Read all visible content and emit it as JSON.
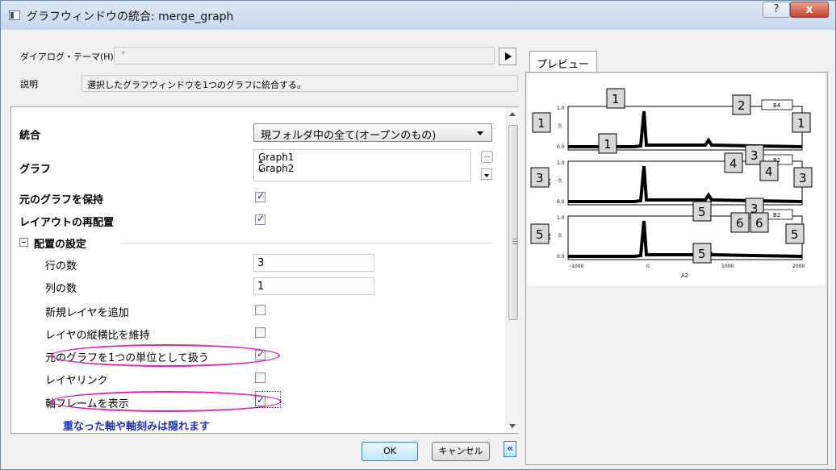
{
  "window": {
    "title": "グラフウィンドウの統合: merge_graph",
    "help_label": "?",
    "close_label": "x"
  },
  "header": {
    "theme_label": "ダイアログ・テーマ(H)",
    "theme_value": "*",
    "description_label": "説明",
    "description_value": "選択したグラフウィンドウを1つのグラフに統合する。"
  },
  "settings": {
    "merge_label": "統合",
    "merge_value": "現フォルダ中の全て(オープンのもの)",
    "graphs_label": "グラフ",
    "graphs": [
      "Graph1",
      "Graph2"
    ],
    "ellipsis_label": "...",
    "keep_source_label": "元のグラフを保持",
    "keep_source_checked": true,
    "rearrange_label": "レイアウトの再配置",
    "rearrange_checked": true,
    "arrangement_group_label": "配置の設定",
    "rows_label": "行の数",
    "rows_value": "3",
    "cols_label": "列の数",
    "cols_value": "1",
    "add_layer_label": "新規レイヤを追加",
    "add_layer_checked": false,
    "keep_ratio_label": "レイヤの縦横比を維持",
    "keep_ratio_checked": false,
    "treat_unit_label": "元のグラフを1つの単位として扱う",
    "treat_unit_checked": true,
    "layer_link_label": "レイヤリンク",
    "layer_link_checked": false,
    "show_frame_label": "軸フレームを表示",
    "show_frame_checked": true,
    "note": "重なった軸や軸刻みは隠れます"
  },
  "buttons": {
    "ok": "OK",
    "cancel": "キャンセル",
    "collapse": "«"
  },
  "preview": {
    "tab_label": "プレビュー",
    "panels": [
      {
        "ylabel": "B4",
        "legend": "B4",
        "tick_top": "1.0",
        "tick_mid": "0.",
        "tick_bottom": "0.0"
      },
      {
        "ylabel": "B1",
        "legend": "B1",
        "tick_top": "1.0",
        "tick_mid": "0.",
        "tick_bottom": "0.0"
      },
      {
        "ylabel": "B2",
        "legend": "B2",
        "tick_top": "1.0",
        "tick_mid": "0.",
        "tick_bottom": "0.0"
      }
    ],
    "x_ticks": [
      "-1000",
      "0",
      "1000",
      "2000"
    ],
    "x_label": "A2",
    "markers": [
      "1",
      "1",
      "2",
      "1",
      "1",
      "3",
      "4",
      "3",
      "4",
      "3",
      "5",
      "3",
      "6",
      "6",
      "5",
      "5",
      "5"
    ]
  }
}
